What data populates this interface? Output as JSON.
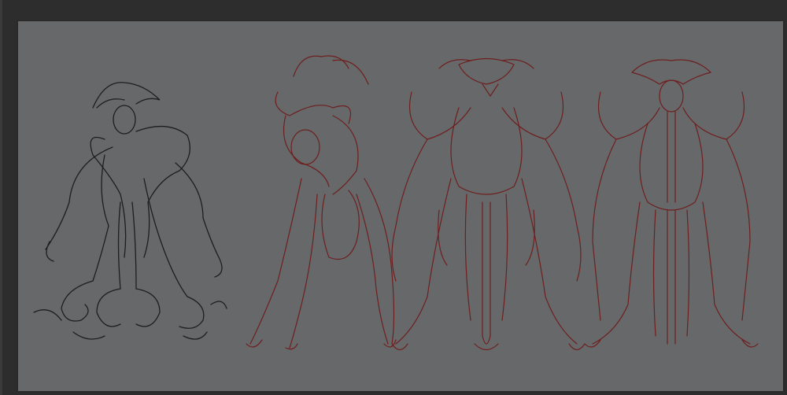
{
  "colors": {
    "workspace": "#2d2d2d",
    "canvas": "#67686a",
    "sketch_line": "#1e1e1e",
    "redline": "#6e1f1f"
  }
}
